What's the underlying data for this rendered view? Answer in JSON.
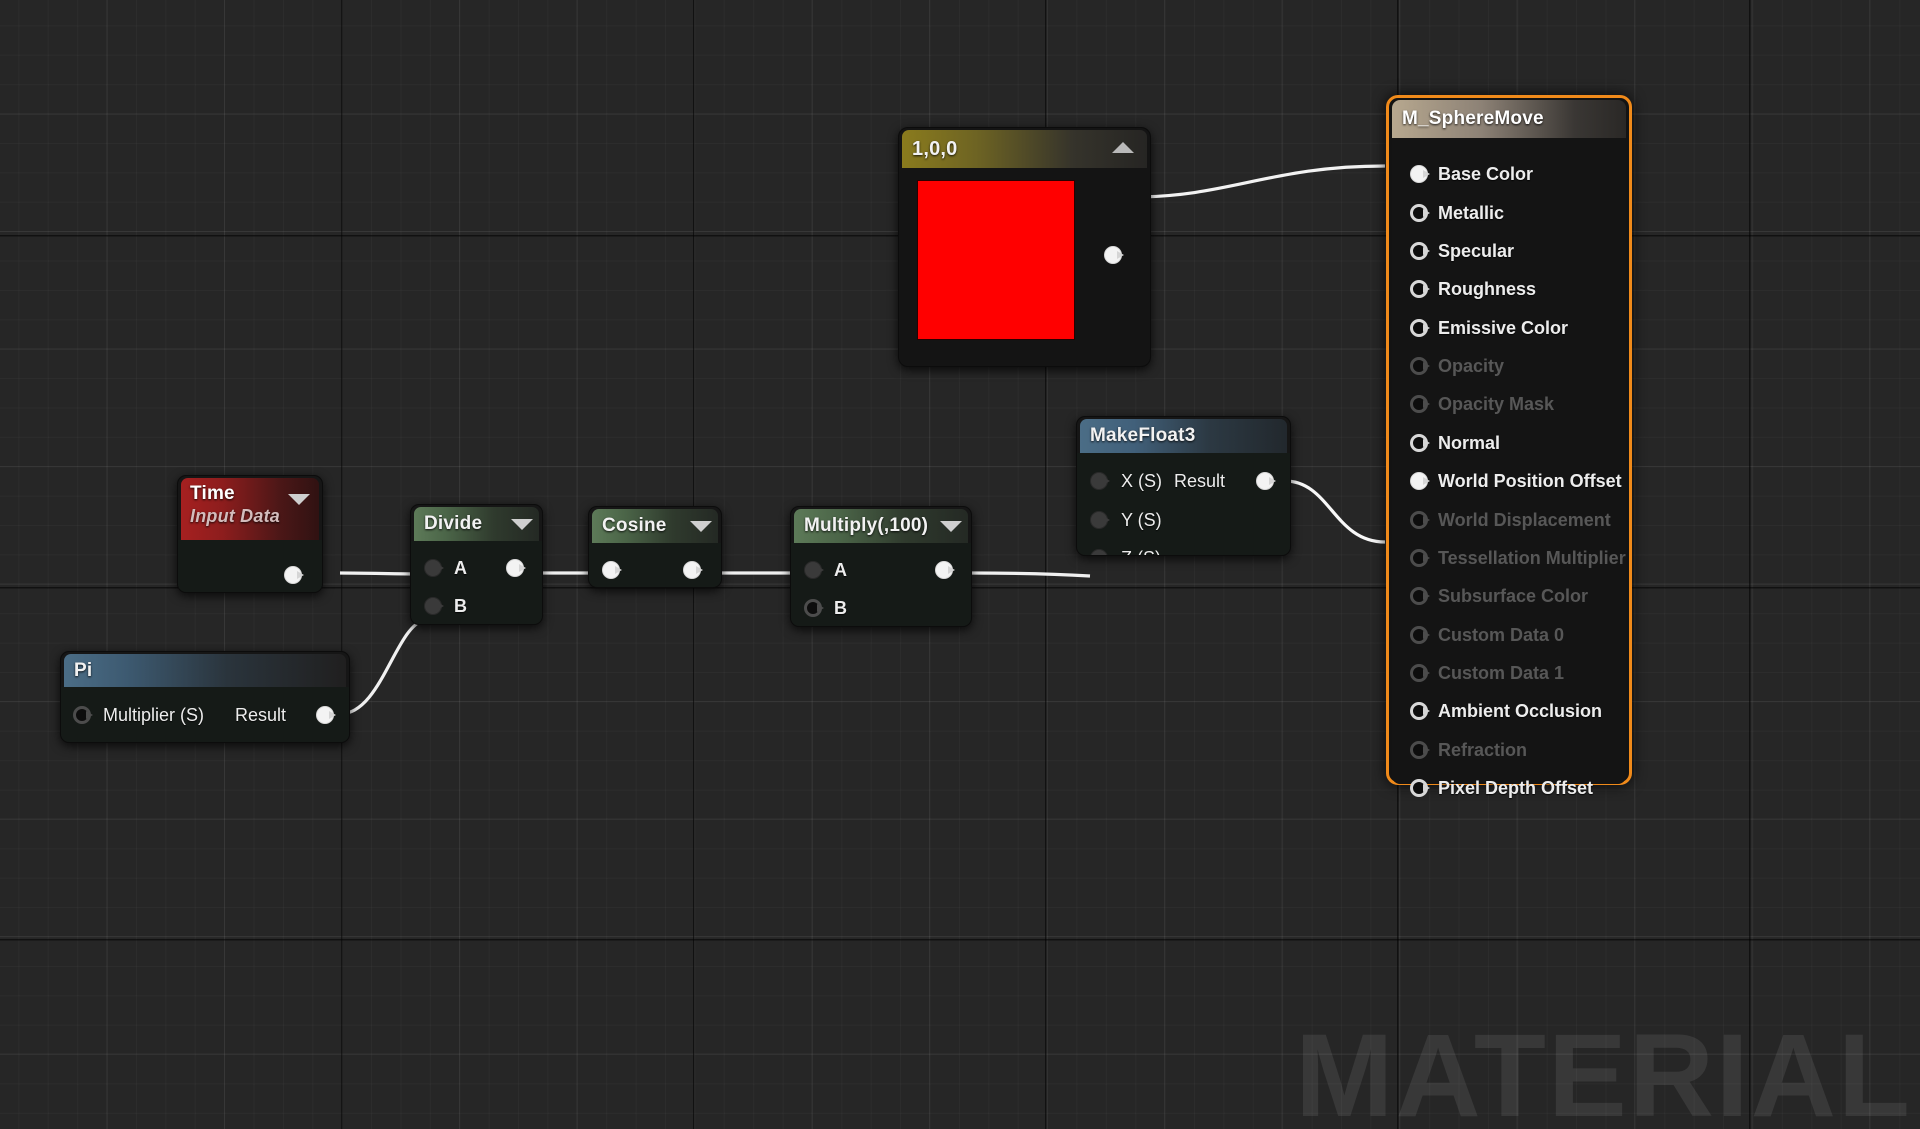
{
  "editor": {
    "watermark": "MATERIAL",
    "canvas_background": "#262626",
    "selection_color": "#f08a1a"
  },
  "material_node": {
    "title": "M_SphereMove",
    "selected": true,
    "inputs": [
      {
        "label": "Base Color",
        "connected": true,
        "enabled": true
      },
      {
        "label": "Metallic",
        "connected": false,
        "enabled": true
      },
      {
        "label": "Specular",
        "connected": false,
        "enabled": true
      },
      {
        "label": "Roughness",
        "connected": false,
        "enabled": true
      },
      {
        "label": "Emissive Color",
        "connected": false,
        "enabled": true
      },
      {
        "label": "Opacity",
        "connected": false,
        "enabled": false
      },
      {
        "label": "Opacity Mask",
        "connected": false,
        "enabled": false
      },
      {
        "label": "Normal",
        "connected": false,
        "enabled": true
      },
      {
        "label": "World Position Offset",
        "connected": true,
        "enabled": true
      },
      {
        "label": "World Displacement",
        "connected": false,
        "enabled": false
      },
      {
        "label": "Tessellation Multiplier",
        "connected": false,
        "enabled": false
      },
      {
        "label": "Subsurface Color",
        "connected": false,
        "enabled": false
      },
      {
        "label": "Custom Data 0",
        "connected": false,
        "enabled": false
      },
      {
        "label": "Custom Data 1",
        "connected": false,
        "enabled": false
      },
      {
        "label": "Ambient Occlusion",
        "connected": false,
        "enabled": true
      },
      {
        "label": "Refraction",
        "connected": false,
        "enabled": false
      },
      {
        "label": "Pixel Depth Offset",
        "connected": false,
        "enabled": true
      }
    ]
  },
  "color_node": {
    "title": "1,0,0",
    "swatch_color": "#ff0000",
    "collapse_icon": "caret-up-icon",
    "output_connected": true
  },
  "makefloat3_node": {
    "title": "MakeFloat3",
    "inputs": [
      {
        "label": "X (S)",
        "connected": false
      },
      {
        "label": "Y (S)",
        "connected": false
      },
      {
        "label": "Z (S)",
        "connected": true
      }
    ],
    "output": {
      "label": "Result",
      "connected": true
    }
  },
  "pi_node": {
    "title": "Pi",
    "input": {
      "label": "Multiplier (S)",
      "connected": false
    },
    "output": {
      "label": "Result",
      "connected": true
    }
  },
  "time_node": {
    "title": "Time",
    "subtitle": "Input Data",
    "dropdown_icon": "caret-down-icon",
    "output_connected": true
  },
  "divide_node": {
    "title": "Divide",
    "dropdown_icon": "caret-down-icon",
    "inputs": [
      {
        "label": "A",
        "connected": true
      },
      {
        "label": "B",
        "connected": true
      }
    ],
    "output_connected": true
  },
  "cosine_node": {
    "title": "Cosine",
    "dropdown_icon": "caret-down-icon",
    "input_connected": true,
    "output_connected": true
  },
  "multiply_node": {
    "title": "Multiply(,100)",
    "dropdown_icon": "caret-down-icon",
    "inputs": [
      {
        "label": "A",
        "connected": true
      },
      {
        "label": "B",
        "connected": false
      }
    ],
    "output_connected": true
  },
  "connections": [
    {
      "from": "color_node.output",
      "to": "material_node.Base Color"
    },
    {
      "from": "time_node.output",
      "to": "divide_node.A"
    },
    {
      "from": "pi_node.Result",
      "to": "divide_node.B"
    },
    {
      "from": "divide_node.output",
      "to": "cosine_node.input"
    },
    {
      "from": "cosine_node.output",
      "to": "multiply_node.A"
    },
    {
      "from": "multiply_node.output",
      "to": "makefloat3_node.Z (S)"
    },
    {
      "from": "makefloat3_node.Result",
      "to": "material_node.World Position Offset"
    }
  ]
}
